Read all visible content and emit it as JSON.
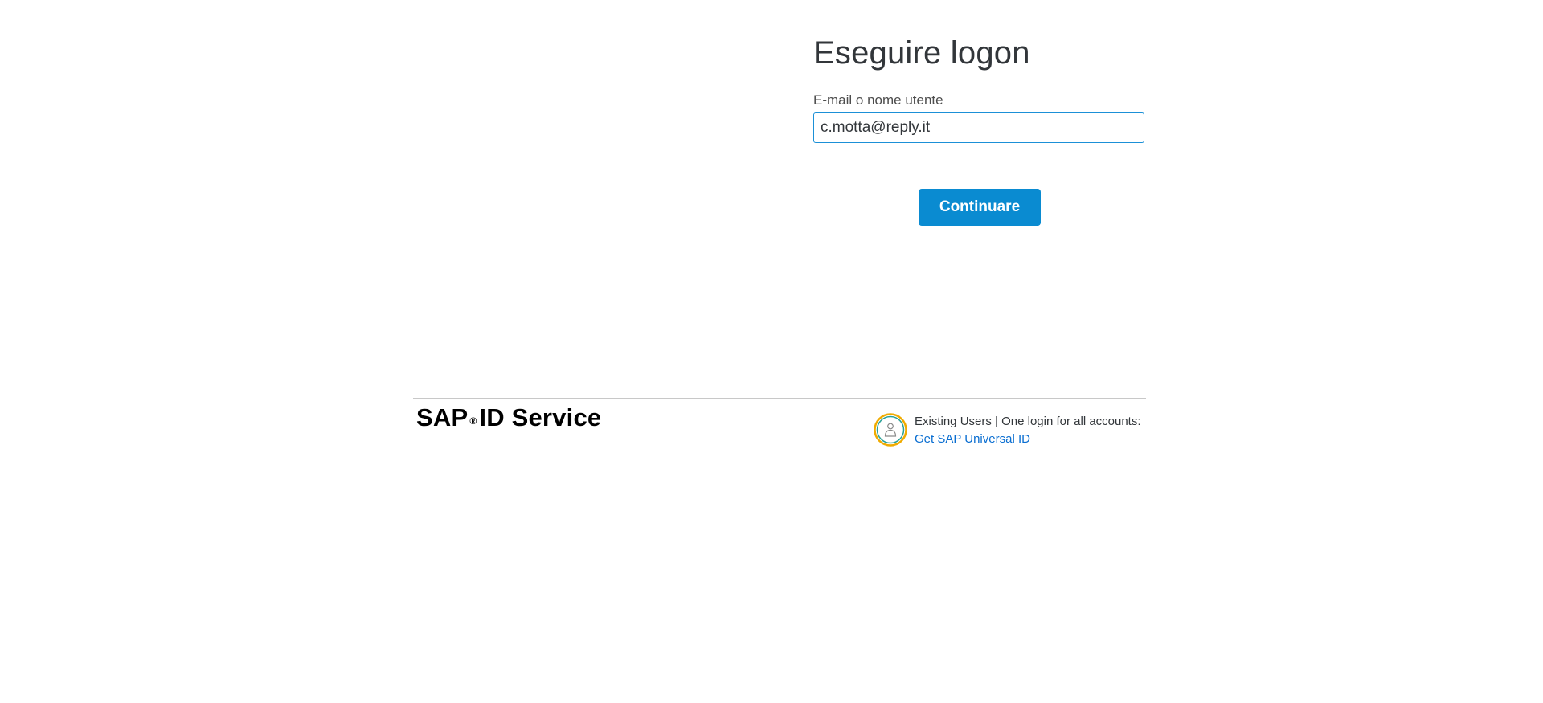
{
  "login": {
    "title": "Eseguire logon",
    "field_label": "E-mail o nome utente",
    "field_value": "c.motta@reply.it",
    "continue_label": "Continuare"
  },
  "footer": {
    "brand_sap": "SAP",
    "brand_reg": "®",
    "brand_rest": "ID Service",
    "universal_text": "Existing Users | One login for all accounts:",
    "universal_link": "Get SAP Universal ID",
    "universal_icon": "user-badge-icon"
  },
  "colors": {
    "accent": "#0a8bd1",
    "link": "#0a6ed1",
    "input_border": "#1b90d7"
  }
}
